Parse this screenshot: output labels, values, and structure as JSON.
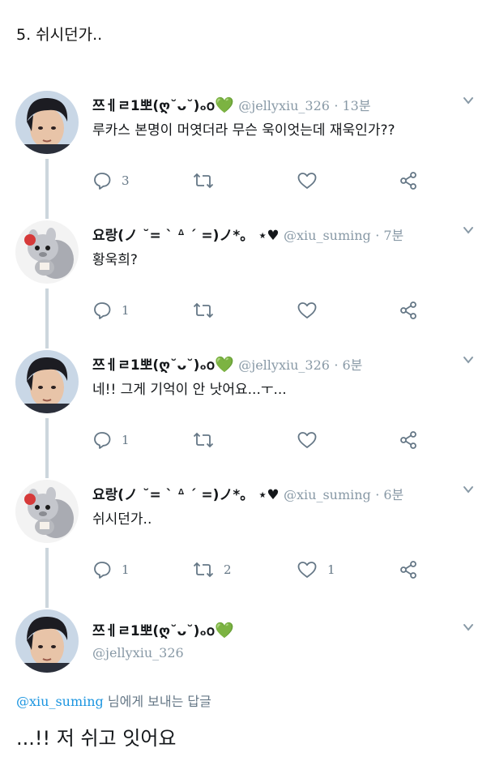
{
  "heading": "5. 쉬시던가..",
  "tweets": [
    {
      "display_name": "쯔ㅔㄹ1뽀(ღ˘ᴗ˘)ₒ𝗈",
      "emoji": "💚",
      "handle": "@jellyxiu_326",
      "time": "· 13분",
      "text": "루카스 본명이 머엿더라 무슨 욱이엇는데 재욱인가??",
      "counts": {
        "reply": "3",
        "retweet": "",
        "like": ""
      }
    },
    {
      "display_name": "요랑(ノ ˘= ˋ ᐞ ˊ =)ノ*。",
      "emoji": "⋆♥",
      "handle": "@xiu_suming",
      "time": "· 7분",
      "text": "황욱희?",
      "counts": {
        "reply": "1",
        "retweet": "",
        "like": ""
      }
    },
    {
      "display_name": "쯔ㅔㄹ1뽀(ღ˘ᴗ˘)ₒ𝗈",
      "emoji": "💚",
      "handle": "@jellyxiu_326",
      "time": "· 6분",
      "text": "네!! 그게 기억이 안 낫어요...ㅜ...",
      "counts": {
        "reply": "1",
        "retweet": "",
        "like": ""
      }
    },
    {
      "display_name": "요랑(ノ ˘= ˋ ᐞ ˊ =)ノ*。",
      "emoji": "⋆♥",
      "handle": "@xiu_suming",
      "time": "· 6분",
      "text": "쉬시던가..",
      "counts": {
        "reply": "1",
        "retweet": "2",
        "like": "1"
      }
    }
  ],
  "final_tweet": {
    "display_name": "쯔ㅔㄹ1뽀(ღ˘ᴗ˘)ₒ𝗈",
    "emoji": "💚",
    "handle": "@jellyxiu_326",
    "reply_mention": "@xiu_suming",
    "reply_context": "님에게 보내는 답글",
    "text": "...!! 저 쉬고 잇어요"
  },
  "colors": {
    "accent_blue": "#1b95e0",
    "muted_gray": "#657786",
    "thread_line": "#ccd6dd",
    "heart_green": "#6aa84f"
  },
  "icons": [
    "chevron-down-icon",
    "reply-icon",
    "retweet-icon",
    "like-icon",
    "share-icon"
  ]
}
